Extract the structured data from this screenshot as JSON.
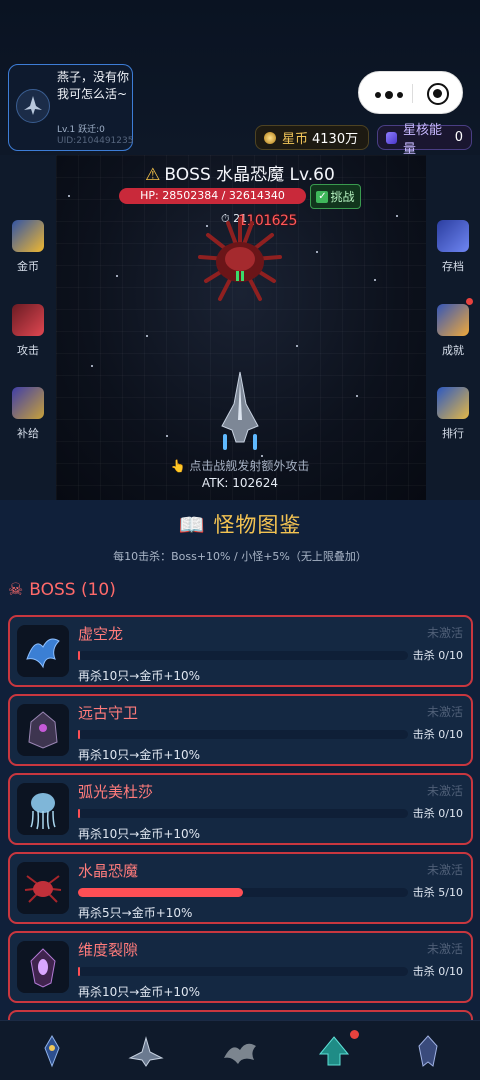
{
  "profile": {
    "name": "燕子，没有你我可怎么活~",
    "level": "Lv.1 跃迁:0",
    "uid": "UID:2104491235"
  },
  "currency": {
    "coin_label": "星币",
    "coin_value": "4130万",
    "core_label": "星核能量",
    "core_value": "0"
  },
  "battle": {
    "boss_title": "BOSS 水晶恐魔 Lv.60",
    "hp_text": "HP: 28502384 / 32614340",
    "hp_fraction": 0.874,
    "challenge_label": "挑战",
    "timer_label": "21",
    "damage_popup": "1101625",
    "hint": "点击战舰发射额外攻击",
    "atk": "ATK: 102624"
  },
  "left_menu": [
    {
      "label": "金币",
      "icon": "coin-rocket-icon"
    },
    {
      "label": "攻击",
      "icon": "crossed-swords-icon"
    },
    {
      "label": "补给",
      "icon": "supply-crate-icon"
    }
  ],
  "right_menu": [
    {
      "label": "存档",
      "icon": "save-disk-icon"
    },
    {
      "label": "成就",
      "icon": "trophy-icon"
    },
    {
      "label": "排行",
      "icon": "leaderboard-icon"
    }
  ],
  "codex": {
    "title": "怪物图鉴",
    "subtitle": "每10击杀：Boss+10% / 小怪+5%（无上限叠加）",
    "section_title": "BOSS (10)",
    "entries": [
      {
        "name": "虚空龙",
        "state": "未激活",
        "kills": "击杀 0/10",
        "progress": 0.0,
        "reward": "再杀10只→金币+10%"
      },
      {
        "name": "远古守卫",
        "state": "未激活",
        "kills": "击杀 0/10",
        "progress": 0.0,
        "reward": "再杀10只→金币+10%"
      },
      {
        "name": "弧光美杜莎",
        "state": "未激活",
        "kills": "击杀 0/10",
        "progress": 0.0,
        "reward": "再杀10只→金币+10%"
      },
      {
        "name": "水晶恐魔",
        "state": "未激活",
        "kills": "击杀 5/10",
        "progress": 0.5,
        "reward": "再杀5只→金币+10%"
      },
      {
        "name": "维度裂隙",
        "state": "未激活",
        "kills": "击杀 0/10",
        "progress": 0.0,
        "reward": "再杀10只→金币+10%"
      }
    ]
  },
  "nav": [
    "emblem-icon",
    "fleet-icon",
    "dragon-icon",
    "upgrade-arrow-icon",
    "badge-icon"
  ],
  "colors": {
    "accent": "#f4c352",
    "boss_red": "#ff6a6a",
    "hp_red": "#c9293a",
    "panel": "#142842"
  }
}
